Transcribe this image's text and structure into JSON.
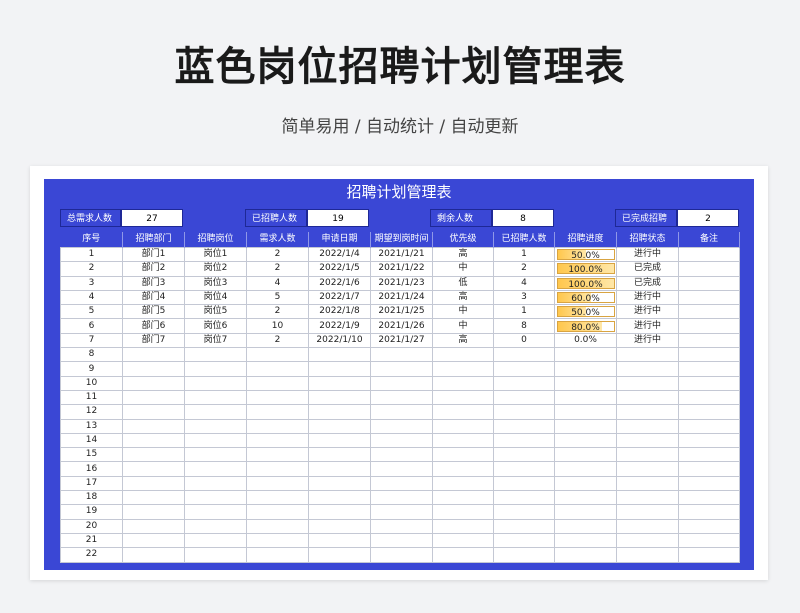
{
  "header": {
    "title": "蓝色岗位招聘计划管理表",
    "subtitle": "简单易用 / 自动统计 / 自动更新"
  },
  "sheet": {
    "title": "招聘计划管理表",
    "summary": [
      {
        "label": "总需求人数",
        "value": "27"
      },
      {
        "label": "已招聘人数",
        "value": "19"
      },
      {
        "label": "剩余人数",
        "value": "8"
      },
      {
        "label": "已完成招聘",
        "value": "2"
      }
    ],
    "columns": [
      "序号",
      "招聘部门",
      "招聘岗位",
      "需求人数",
      "申请日期",
      "期望到岗时间",
      "优先级",
      "已招聘人数",
      "招聘进度",
      "招聘状态",
      "备注"
    ],
    "rows": [
      {
        "no": "1",
        "dept": "部门1",
        "post": "岗位1",
        "need": "2",
        "apply": "2022/1/4",
        "expect": "2021/1/21",
        "priority": "高",
        "hired": "1",
        "progress_text": "50.0%",
        "progress": 0.5,
        "status": "进行中",
        "note": ""
      },
      {
        "no": "2",
        "dept": "部门2",
        "post": "岗位2",
        "need": "2",
        "apply": "2022/1/5",
        "expect": "2021/1/22",
        "priority": "中",
        "hired": "2",
        "progress_text": "100.0%",
        "progress": 1.0,
        "status": "已完成",
        "note": ""
      },
      {
        "no": "3",
        "dept": "部门3",
        "post": "岗位3",
        "need": "4",
        "apply": "2022/1/6",
        "expect": "2021/1/23",
        "priority": "低",
        "hired": "4",
        "progress_text": "100.0%",
        "progress": 1.0,
        "status": "已完成",
        "note": ""
      },
      {
        "no": "4",
        "dept": "部门4",
        "post": "岗位4",
        "need": "5",
        "apply": "2022/1/7",
        "expect": "2021/1/24",
        "priority": "高",
        "hired": "3",
        "progress_text": "60.0%",
        "progress": 0.6,
        "status": "进行中",
        "note": ""
      },
      {
        "no": "5",
        "dept": "部门5",
        "post": "岗位5",
        "need": "2",
        "apply": "2022/1/8",
        "expect": "2021/1/25",
        "priority": "中",
        "hired": "1",
        "progress_text": "50.0%",
        "progress": 0.5,
        "status": "进行中",
        "note": ""
      },
      {
        "no": "6",
        "dept": "部门6",
        "post": "岗位6",
        "need": "10",
        "apply": "2022/1/9",
        "expect": "2021/1/26",
        "priority": "中",
        "hired": "8",
        "progress_text": "80.0%",
        "progress": 0.8,
        "status": "进行中",
        "note": ""
      },
      {
        "no": "7",
        "dept": "部门7",
        "post": "岗位7",
        "need": "2",
        "apply": "2022/1/10",
        "expect": "2021/1/27",
        "priority": "高",
        "hired": "0",
        "progress_text": "0.0%",
        "progress": 0.0,
        "status": "进行中",
        "note": ""
      },
      {
        "no": "8"
      },
      {
        "no": "9"
      },
      {
        "no": "10"
      },
      {
        "no": "11"
      },
      {
        "no": "12"
      },
      {
        "no": "13"
      },
      {
        "no": "14"
      },
      {
        "no": "15"
      },
      {
        "no": "16"
      },
      {
        "no": "17"
      },
      {
        "no": "18"
      },
      {
        "no": "19"
      },
      {
        "no": "20"
      },
      {
        "no": "21"
      },
      {
        "no": "22"
      }
    ]
  },
  "colors": {
    "sheet_blue": "#3a47d5",
    "progress_fill": "#ffc74d",
    "progress_border": "#d9a441"
  }
}
